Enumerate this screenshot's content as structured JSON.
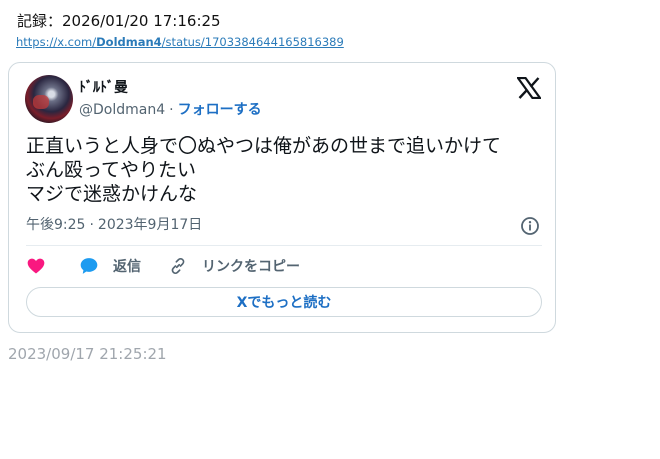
{
  "record": {
    "text": "記録：2026/01/20 17:16:25"
  },
  "link": {
    "prefix": "https://x.com/",
    "user": "Doldman4",
    "suffix": "/status/1703384644165816389"
  },
  "tweet": {
    "display_name": "ﾄﾞﾙﾄﾞ曼",
    "handle": "@Doldman4",
    "separator": "·",
    "follow_label": "フォローする",
    "text": "正直いうと人身で〇ぬやつは俺があの世まで追いかけて\nぶん殴ってやりたい\nマジで迷惑かけんな",
    "time": "午後9:25",
    "date": "2023年9月17日",
    "actions": {
      "reply_label": "返信",
      "copy_link_label": "リンクをコピー"
    },
    "read_more_label": "Xでもっと読む"
  },
  "footer": {
    "date": "2023/09/17 21:25:21"
  },
  "colors": {
    "accent": "#1d6fc4",
    "like": "#f91880",
    "reply": "#1d9bf0",
    "muted": "#536471"
  },
  "icons": [
    "x-logo-icon",
    "info-icon",
    "heart-icon",
    "speech-bubble-icon",
    "link-icon"
  ]
}
